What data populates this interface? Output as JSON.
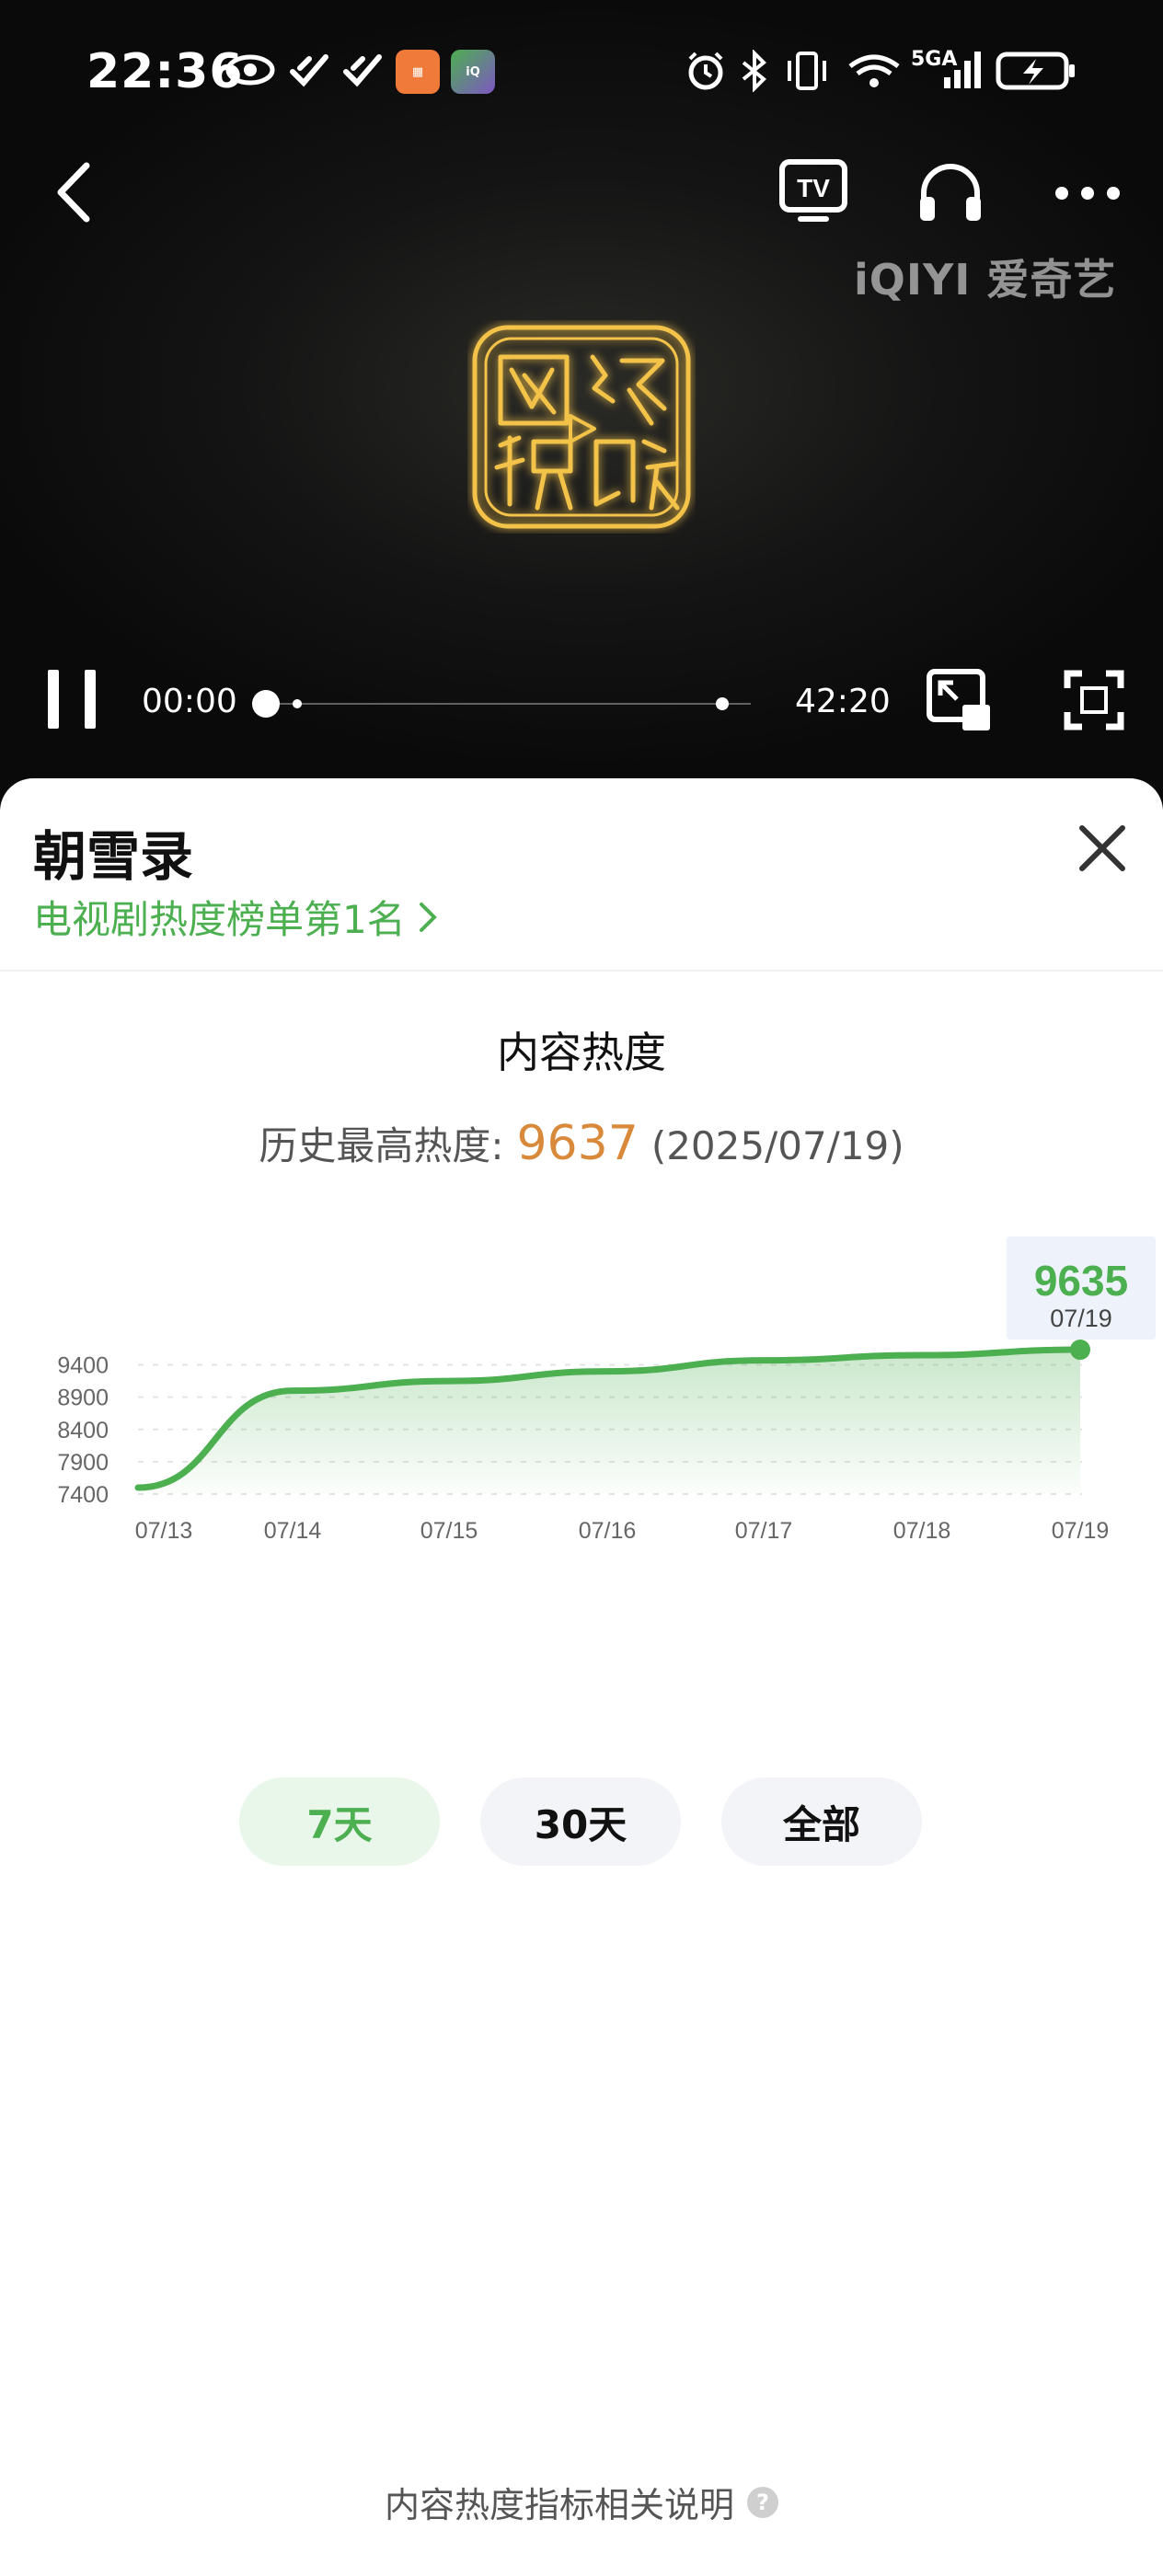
{
  "status_bar": {
    "time": "22:36",
    "network": "5GA"
  },
  "player": {
    "watermark": "iQIYI 爱奇艺",
    "current_time": "00:00",
    "total_time": "42:20",
    "progress": 0
  },
  "sheet": {
    "title": "朝雪录",
    "rank_link": "电视剧热度榜单第1名",
    "section_title": "内容热度",
    "peak_label": "历史最高热度:",
    "peak_value": "9637",
    "peak_date": "(2025/07/19)",
    "footer_note": "内容热度指标相关说明",
    "help_icon": "?"
  },
  "tabs": [
    {
      "label": "7天",
      "active": true
    },
    {
      "label": "30天",
      "active": false
    },
    {
      "label": "全部",
      "active": false
    }
  ],
  "colors": {
    "accent_green": "#4caf50",
    "peak_orange": "#d9893a"
  },
  "chart_data": {
    "type": "area",
    "categories": [
      "07/13",
      "07/14",
      "07/15",
      "07/16",
      "07/17",
      "07/18",
      "07/19"
    ],
    "values": [
      7500,
      9000,
      9150,
      9300,
      9470,
      9550,
      9635
    ],
    "yticks": [
      7400,
      7900,
      8400,
      8900,
      9400
    ],
    "ylim": [
      7400,
      9650
    ],
    "grid": "dashed horizontal",
    "highlight": {
      "value": "9635",
      "date": "07/19"
    }
  }
}
